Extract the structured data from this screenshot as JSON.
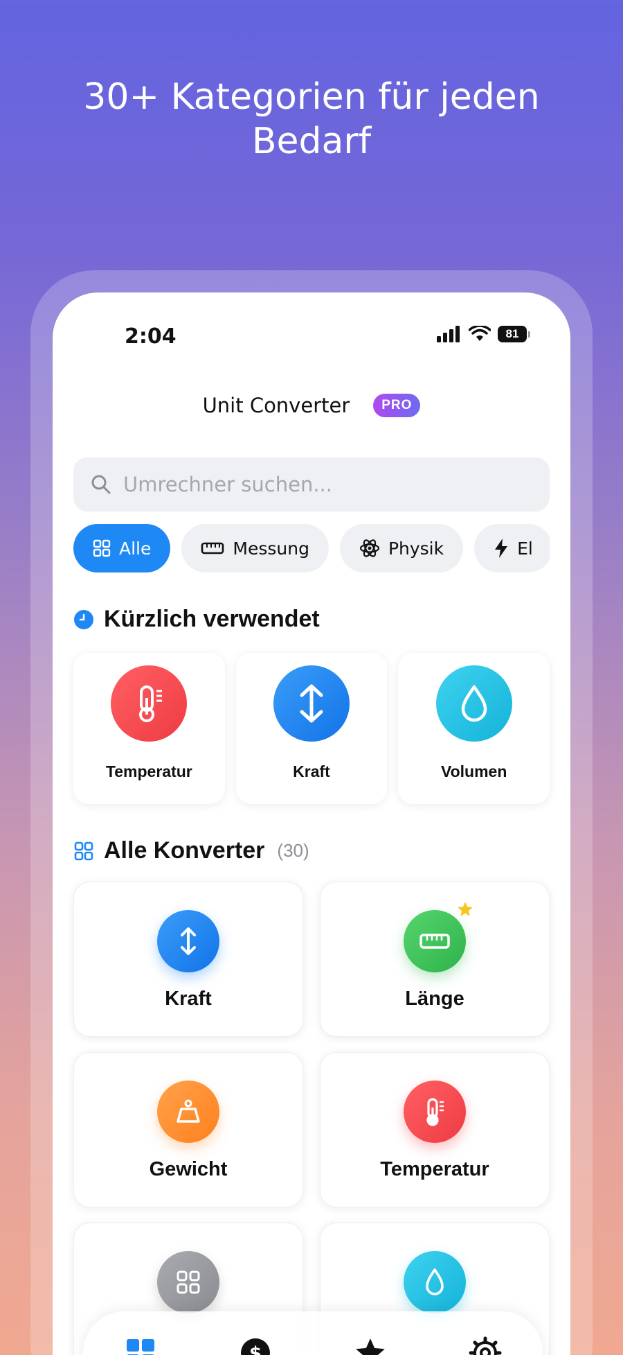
{
  "headline": "30+ Kategorien für jeden Bedarf",
  "status": {
    "time": "2:04",
    "battery": "81"
  },
  "app": {
    "title": "Unit Converter",
    "badge": "PRO"
  },
  "search": {
    "placeholder": "Umrechner suchen..."
  },
  "chips": [
    {
      "label": "Alle",
      "icon": "grid-icon",
      "active": true
    },
    {
      "label": "Messung",
      "icon": "ruler-icon",
      "active": false
    },
    {
      "label": "Physik",
      "icon": "atom-icon",
      "active": false
    },
    {
      "label": "El",
      "icon": "bolt-icon",
      "active": false
    }
  ],
  "recent": {
    "title": "Kürzlich verwendet",
    "items": [
      {
        "label": "Temperatur",
        "icon": "thermometer-icon",
        "color": "#f5484e"
      },
      {
        "label": "Kraft",
        "icon": "up-down-arrow-icon",
        "color": "#1e88f5"
      },
      {
        "label": "Volumen",
        "icon": "droplet-icon",
        "color": "#22c3e6"
      }
    ]
  },
  "all": {
    "title": "Alle Konverter",
    "count": "(30)",
    "items": [
      {
        "label": "Kraft",
        "icon": "up-down-arrow-icon",
        "color": "#1e88f5",
        "favorite": false
      },
      {
        "label": "Länge",
        "icon": "ruler-icon",
        "color": "#3ec45a",
        "favorite": true
      },
      {
        "label": "Gewicht",
        "icon": "weight-icon",
        "color": "#ff9233",
        "favorite": false
      },
      {
        "label": "Temperatur",
        "icon": "thermometer-icon",
        "color": "#f5484e",
        "favorite": false
      },
      {
        "label": "",
        "icon": "grid-icon",
        "color": "#9a9ca0",
        "favorite": false
      },
      {
        "label": "",
        "icon": "droplet-icon",
        "color": "#22c3e6",
        "favorite": false
      }
    ]
  },
  "tabs": [
    {
      "icon": "grid-icon",
      "active": true
    },
    {
      "icon": "dollar-icon",
      "active": false
    },
    {
      "icon": "star-icon",
      "active": false
    },
    {
      "icon": "settings-icon",
      "active": false
    }
  ],
  "colors": {
    "accent": "#1e88f5",
    "favorite": "#f7c51e"
  }
}
